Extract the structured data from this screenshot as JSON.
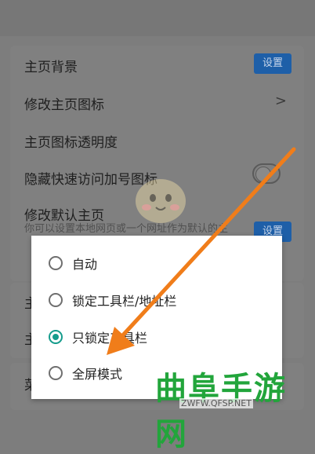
{
  "settings": {
    "homepage_bg": {
      "label": "主页背景",
      "button": "设置"
    },
    "edit_icon": {
      "label": "修改主页图标",
      "chevron": ">"
    },
    "icon_opacity": {
      "label": "主页图标透明度"
    },
    "hide_plus": {
      "label": "隐藏快速访问加号图标"
    },
    "default_home": {
      "label": "修改默认主页",
      "sub": "你可以设置本地网页或一个网址作为默认的主",
      "button": "设置"
    }
  },
  "partial_labels": {
    "row1": "主",
    "row2": "主",
    "row3": "菜"
  },
  "dialog": {
    "options": [
      {
        "label": "自动",
        "selected": false
      },
      {
        "label": "锁定工具栏/地址栏",
        "selected": false
      },
      {
        "label": "只锁定工具栏",
        "selected": true
      },
      {
        "label": "全屏模式",
        "selected": false
      }
    ]
  },
  "watermark": {
    "text": "曲阜手游网",
    "url": "ZWFW.QFSP.NET"
  },
  "colors": {
    "accent": "#159c8c",
    "button": "#1e5fa8",
    "arrow": "#f07d1a",
    "watermark": "#22a53b"
  }
}
